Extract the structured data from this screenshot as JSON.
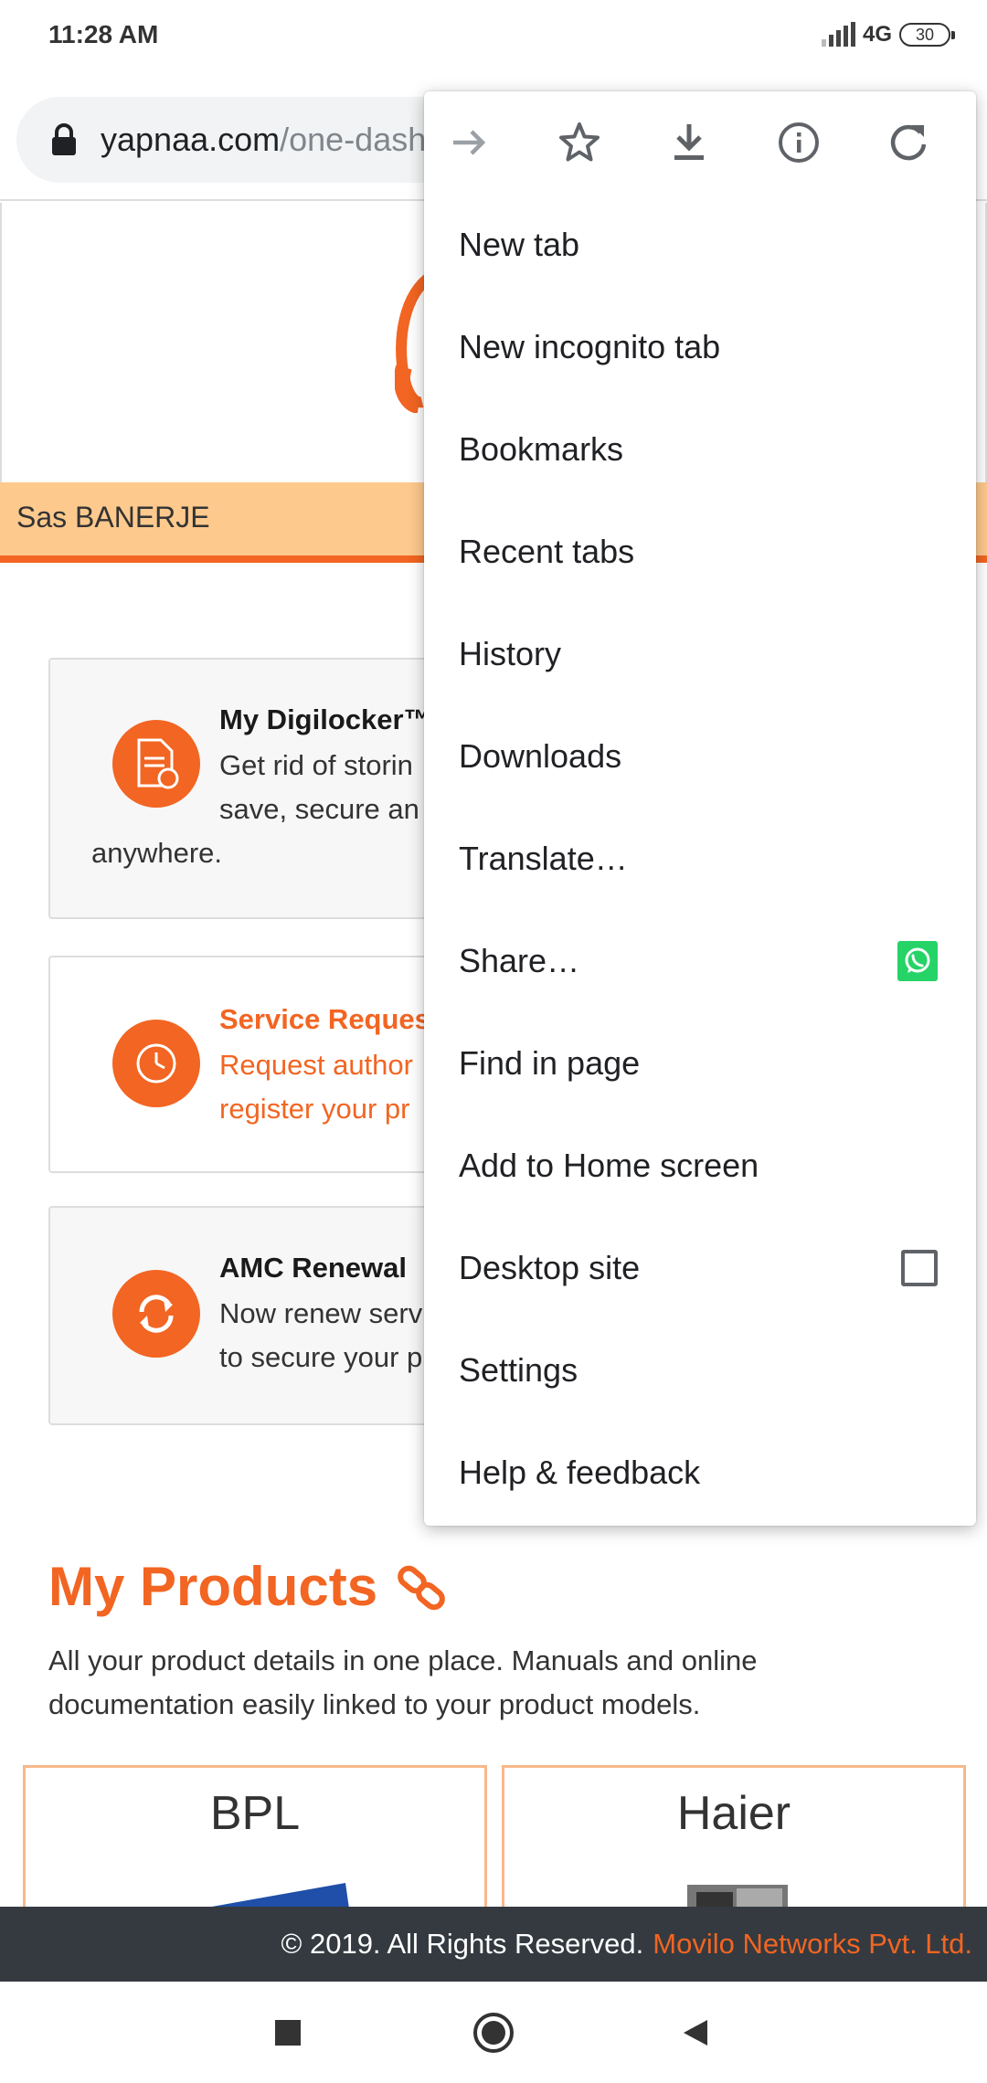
{
  "status_bar": {
    "time": "11:28 AM",
    "network": "4G",
    "battery": "30"
  },
  "omnibox": {
    "url_host": "yapnaa.com",
    "url_path": "/one-dash"
  },
  "menu": {
    "top_icons": [
      "forward-icon",
      "bookmark-star-icon",
      "download-icon",
      "info-icon",
      "refresh-icon"
    ],
    "items": [
      {
        "label": "New tab"
      },
      {
        "label": "New incognito tab"
      },
      {
        "label": "Bookmarks"
      },
      {
        "label": "Recent tabs"
      },
      {
        "label": "History"
      },
      {
        "label": "Downloads"
      },
      {
        "label": "Translate…"
      },
      {
        "label": "Share…"
      },
      {
        "label": "Find in page"
      },
      {
        "label": "Add to Home screen"
      },
      {
        "label": "Desktop site"
      },
      {
        "label": "Settings"
      },
      {
        "label": "Help & feedback"
      }
    ],
    "desktop_site_checked": false
  },
  "page": {
    "user_name": "Sas BANERJE",
    "cards": [
      {
        "title": "My Digilocker™",
        "text_line1": "Get rid of storin",
        "text_line2": "save, secure an",
        "text_line3": "anywhere."
      },
      {
        "title": "Service Reques",
        "text_line1": "Request author",
        "text_line2": "register your pr"
      },
      {
        "title": "AMC Renewal",
        "text_line1": "Now renew serv",
        "text_line2": "to secure your p"
      }
    ],
    "products_title": "My Products",
    "products_desc": "All your product details in one place. Manuals and online documentation easily linked to your product models.",
    "brands": [
      "BPL",
      "Haier"
    ],
    "footer_text": "© 2019. All Rights Reserved.",
    "footer_company": "Movilo Networks Pvt. Ltd."
  },
  "colors": {
    "accent": "#f26522",
    "band": "#fec98d",
    "footer_bg": "#343a40",
    "whatsapp": "#25d366"
  }
}
